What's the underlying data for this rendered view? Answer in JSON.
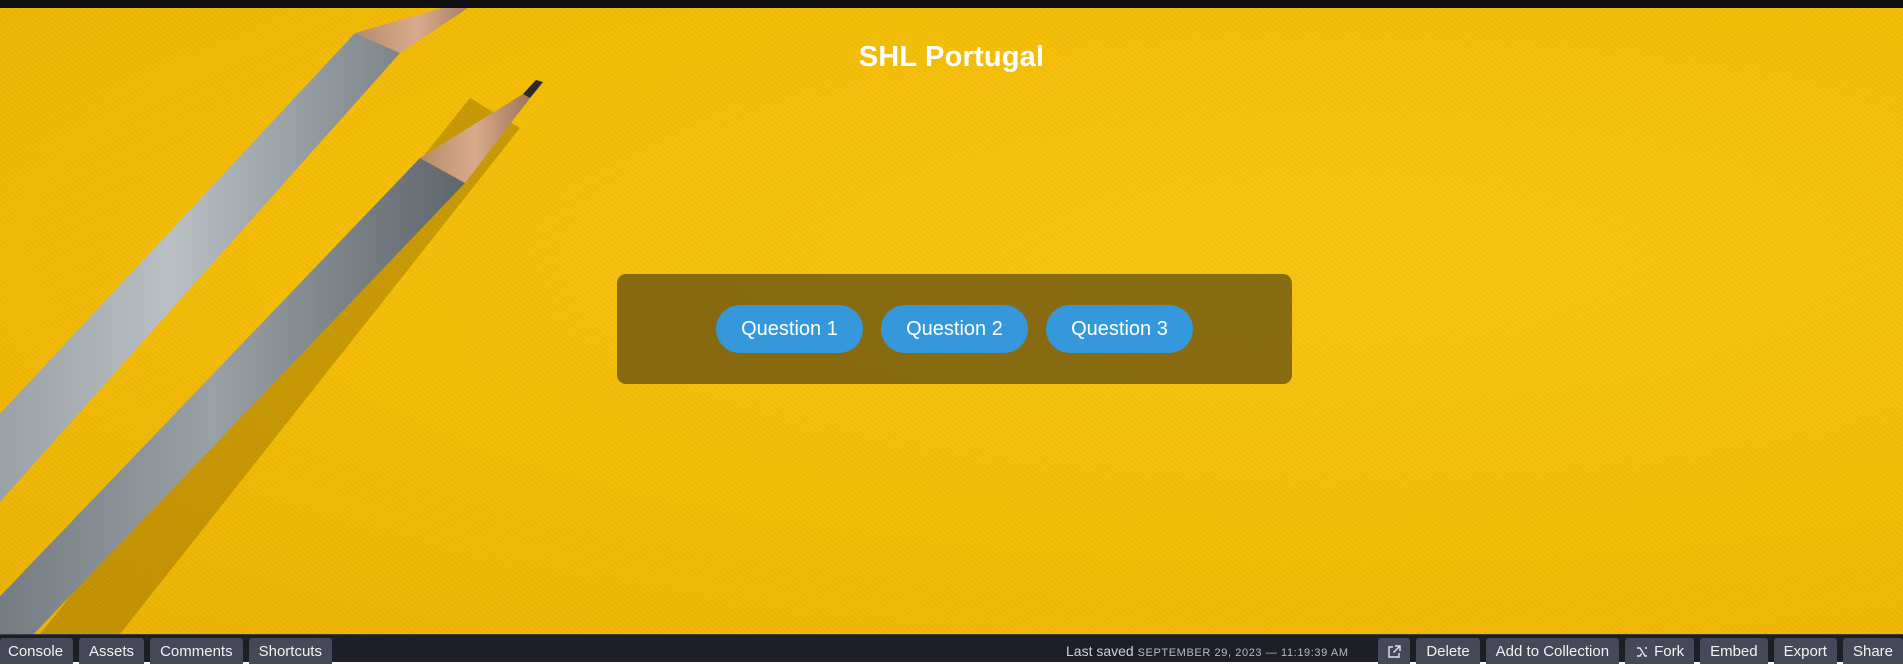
{
  "page": {
    "title": "SHL Portugal"
  },
  "questions": [
    {
      "label": "Question 1"
    },
    {
      "label": "Question 2"
    },
    {
      "label": "Question 3"
    }
  ],
  "toolbar": {
    "left": [
      {
        "label": "Console"
      },
      {
        "label": "Assets"
      },
      {
        "label": "Comments"
      },
      {
        "label": "Shortcuts"
      }
    ],
    "last_saved_label": "Last saved",
    "last_saved_time": "SEPTEMBER 29, 2023 — 11:19:39 AM",
    "right": {
      "open_icon": "external-link-icon",
      "delete": "Delete",
      "add_to_collection": "Add to Collection",
      "fork": "Fork",
      "fork_icon": "fork-icon",
      "embed": "Embed",
      "export": "Export",
      "share": "Share"
    }
  },
  "colors": {
    "background": "#f4bd06",
    "button": "#3498db",
    "panel": "rgba(70,55,20,0.62)",
    "toolbar": "#1e1f26",
    "toolbar_button": "#444857"
  }
}
